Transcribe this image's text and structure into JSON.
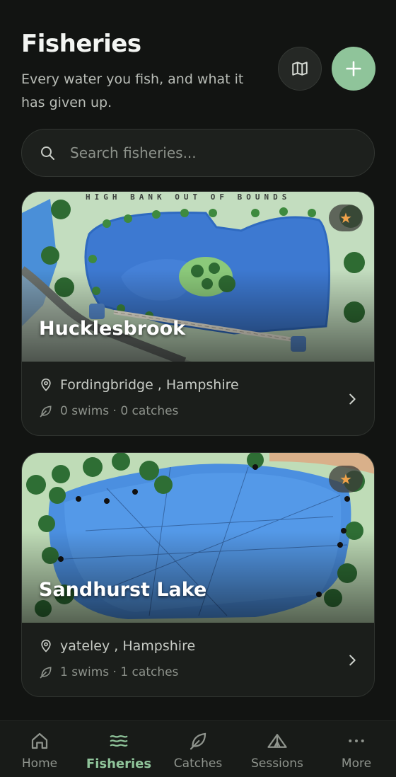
{
  "header": {
    "title": "Fisheries",
    "subtitle": "Every water you fish, and what it has given up."
  },
  "search": {
    "placeholder": "Search fisheries..."
  },
  "fisheries": [
    {
      "name": "Hucklesbrook",
      "location": "Fordingbridge , Hampshire",
      "stats": "0 swims · 0 catches",
      "favorite": true,
      "map_caption": "HIGH BANK OUT OF BOUNDS"
    },
    {
      "name": "Sandhurst Lake",
      "location": "yateley , Hampshire",
      "stats": "1 swims · 1 catches",
      "favorite": true
    }
  ],
  "nav": {
    "items": [
      {
        "label": "Home",
        "icon": "home-icon"
      },
      {
        "label": "Fisheries",
        "icon": "waves-icon",
        "active": true
      },
      {
        "label": "Catches",
        "icon": "leaf-icon"
      },
      {
        "label": "Sessions",
        "icon": "tent-icon"
      },
      {
        "label": "More",
        "icon": "more-dots-icon"
      }
    ]
  },
  "colors": {
    "accent": "#8fc49a",
    "star": "#f0a24a",
    "background": "#121412"
  }
}
